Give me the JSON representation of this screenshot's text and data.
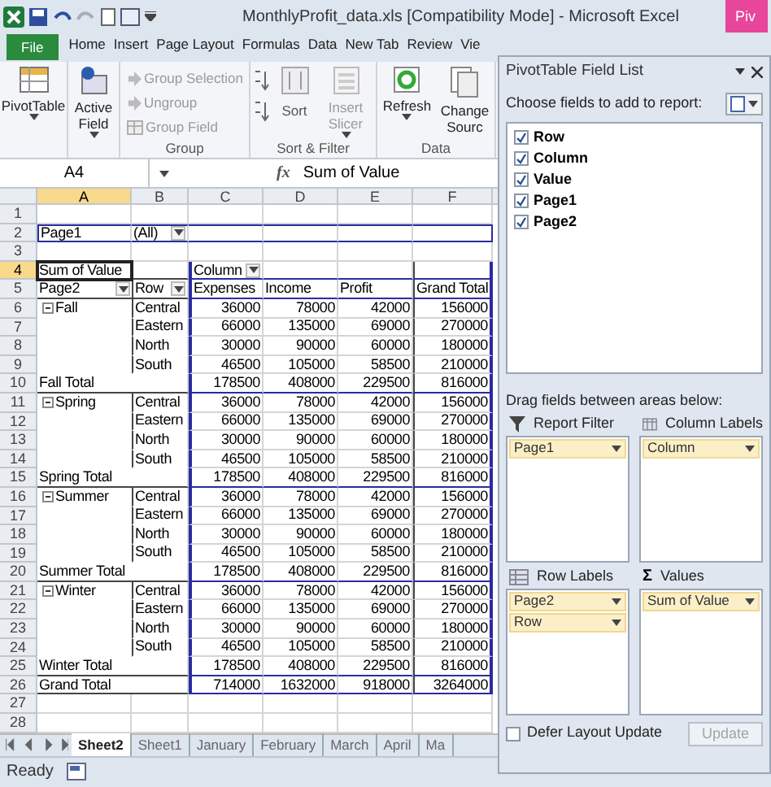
{
  "title_bar": {
    "title": "MonthlyProfit_data.xls  [Compatibility Mode]  -  Microsoft Excel",
    "context_tab": "Piv"
  },
  "ribbon_tabs": [
    {
      "label": "File",
      "kind": "file",
      "selected": false
    },
    {
      "label": "Home",
      "kind": "tab",
      "selected": false
    },
    {
      "label": "Insert",
      "kind": "tab",
      "selected": false
    },
    {
      "label": "Page Layout",
      "kind": "tab",
      "selected": false
    },
    {
      "label": "Formulas",
      "kind": "tab",
      "selected": false
    },
    {
      "label": "Data",
      "kind": "tab",
      "selected": false
    },
    {
      "label": "New Tab",
      "kind": "tab",
      "selected": false
    },
    {
      "label": "Review",
      "kind": "tab",
      "selected": false
    },
    {
      "label": "Vie",
      "kind": "tab",
      "selected": false
    }
  ],
  "ribbon_groups": [
    {
      "buttons": [
        {
          "label": "PivotTable",
          "kind": "large",
          "disabled": false,
          "dropdown": true
        }
      ]
    },
    {
      "buttons": [
        {
          "label": "Active Field",
          "kind": "large",
          "disabled": false,
          "dropdown": true
        }
      ]
    },
    {
      "label": "Group",
      "buttons": [
        {
          "label": "Group Selection",
          "kind": "small",
          "disabled": true
        },
        {
          "label": "Ungroup",
          "kind": "small",
          "disabled": true
        },
        {
          "label": "Group Field",
          "kind": "small",
          "disabled": true
        }
      ]
    },
    {
      "label": "Sort & Filter",
      "buttons": [
        {
          "label": "Sort",
          "kind": "sort",
          "disabled": false
        },
        {
          "label": "Insert Slicer",
          "kind": "large",
          "disabled": true,
          "dropdown": true
        }
      ]
    },
    {
      "label": "Data",
      "buttons": [
        {
          "label": "Refresh",
          "kind": "large",
          "disabled": false,
          "dropdown": true
        },
        {
          "label": "Change Sourc",
          "kind": "large",
          "disabled": false
        }
      ]
    }
  ],
  "formula_bar": {
    "name_box": "A4",
    "function_label": "fx",
    "value": "Sum of Value"
  },
  "sheet": {
    "columns": [
      {
        "label": "A",
        "selected": true
      },
      {
        "label": "B",
        "selected": false
      },
      {
        "label": "C",
        "selected": false
      },
      {
        "label": "D",
        "selected": false
      },
      {
        "label": "E",
        "selected": false
      },
      {
        "label": "F",
        "selected": false
      }
    ],
    "rows": [
      {
        "num": "1",
        "kind": "blank",
        "selected": false
      },
      {
        "num": "2",
        "kind": "filter",
        "selected": false,
        "cells": {
          "A": "Page1",
          "B": "(All)"
        }
      },
      {
        "num": "3",
        "kind": "blank",
        "selected": false
      },
      {
        "num": "4",
        "kind": "column_labels",
        "selected": true,
        "cells": {
          "A": "Sum of Value",
          "C": "Column"
        }
      },
      {
        "num": "5",
        "kind": "field_header",
        "selected": false,
        "cells": {
          "A": "Page2",
          "B": "Row",
          "C": "Expenses",
          "D": "Income",
          "E": "Profit",
          "F": "Grand Total"
        }
      },
      {
        "num": "6",
        "kind": "item",
        "selected": false,
        "expanded": true,
        "cells": {
          "A": "Fall",
          "B": "Central",
          "C": "36000",
          "D": "78000",
          "E": "42000",
          "F": "156000"
        }
      },
      {
        "num": "7",
        "kind": "item",
        "selected": false,
        "cells": {
          "B": "Eastern",
          "C": "66000",
          "D": "135000",
          "E": "69000",
          "F": "270000"
        }
      },
      {
        "num": "8",
        "kind": "item",
        "selected": false,
        "cells": {
          "B": "North",
          "C": "30000",
          "D": "90000",
          "E": "60000",
          "F": "180000"
        }
      },
      {
        "num": "9",
        "kind": "item",
        "selected": false,
        "cells": {
          "B": "South",
          "C": "46500",
          "D": "105000",
          "E": "58500",
          "F": "210000"
        }
      },
      {
        "num": "10",
        "kind": "subtotal",
        "selected": false,
        "cells": {
          "A": "Fall Total",
          "C": "178500",
          "D": "408000",
          "E": "229500",
          "F": "816000"
        }
      },
      {
        "num": "11",
        "kind": "item",
        "selected": false,
        "expanded": true,
        "cells": {
          "A": "Spring",
          "B": "Central",
          "C": "36000",
          "D": "78000",
          "E": "42000",
          "F": "156000"
        }
      },
      {
        "num": "12",
        "kind": "item",
        "selected": false,
        "cells": {
          "B": "Eastern",
          "C": "66000",
          "D": "135000",
          "E": "69000",
          "F": "270000"
        }
      },
      {
        "num": "13",
        "kind": "item",
        "selected": false,
        "cells": {
          "B": "North",
          "C": "30000",
          "D": "90000",
          "E": "60000",
          "F": "180000"
        }
      },
      {
        "num": "14",
        "kind": "item",
        "selected": false,
        "cells": {
          "B": "South",
          "C": "46500",
          "D": "105000",
          "E": "58500",
          "F": "210000"
        }
      },
      {
        "num": "15",
        "kind": "subtotal",
        "selected": false,
        "cells": {
          "A": "Spring Total",
          "C": "178500",
          "D": "408000",
          "E": "229500",
          "F": "816000"
        }
      },
      {
        "num": "16",
        "kind": "item",
        "selected": false,
        "expanded": true,
        "cells": {
          "A": "Summer",
          "B": "Central",
          "C": "36000",
          "D": "78000",
          "E": "42000",
          "F": "156000"
        }
      },
      {
        "num": "17",
        "kind": "item",
        "selected": false,
        "cells": {
          "B": "Eastern",
          "C": "66000",
          "D": "135000",
          "E": "69000",
          "F": "270000"
        }
      },
      {
        "num": "18",
        "kind": "item",
        "selected": false,
        "cells": {
          "B": "North",
          "C": "30000",
          "D": "90000",
          "E": "60000",
          "F": "180000"
        }
      },
      {
        "num": "19",
        "kind": "item",
        "selected": false,
        "cells": {
          "B": "South",
          "C": "46500",
          "D": "105000",
          "E": "58500",
          "F": "210000"
        }
      },
      {
        "num": "20",
        "kind": "subtotal",
        "selected": false,
        "cells": {
          "A": "Summer Total",
          "C": "178500",
          "D": "408000",
          "E": "229500",
          "F": "816000"
        }
      },
      {
        "num": "21",
        "kind": "item",
        "selected": false,
        "expanded": true,
        "cells": {
          "A": "Winter",
          "B": "Central",
          "C": "36000",
          "D": "78000",
          "E": "42000",
          "F": "156000"
        }
      },
      {
        "num": "22",
        "kind": "item",
        "selected": false,
        "cells": {
          "B": "Eastern",
          "C": "66000",
          "D": "135000",
          "E": "69000",
          "F": "270000"
        }
      },
      {
        "num": "23",
        "kind": "item",
        "selected": false,
        "cells": {
          "B": "North",
          "C": "30000",
          "D": "90000",
          "E": "60000",
          "F": "180000"
        }
      },
      {
        "num": "24",
        "kind": "item",
        "selected": false,
        "cells": {
          "B": "South",
          "C": "46500",
          "D": "105000",
          "E": "58500",
          "F": "210000"
        }
      },
      {
        "num": "25",
        "kind": "subtotal",
        "selected": false,
        "cells": {
          "A": "Winter Total",
          "C": "178500",
          "D": "408000",
          "E": "229500",
          "F": "816000"
        }
      },
      {
        "num": "26",
        "kind": "grand_total",
        "selected": false,
        "cells": {
          "A": "Grand Total",
          "C": "714000",
          "D": "1632000",
          "E": "918000",
          "F": "3264000"
        }
      },
      {
        "num": "27",
        "kind": "blank",
        "selected": false
      },
      {
        "num": "28",
        "kind": "blank",
        "selected": false
      }
    ],
    "tabs": [
      {
        "label": "Sheet2",
        "selected": true
      },
      {
        "label": "Sheet1",
        "selected": false
      },
      {
        "label": "January",
        "selected": false
      },
      {
        "label": "February",
        "selected": false
      },
      {
        "label": "March",
        "selected": false
      },
      {
        "label": "April",
        "selected": false
      },
      {
        "label": "Ma",
        "selected": false
      }
    ]
  },
  "status_bar": {
    "text": "Ready"
  },
  "field_list": {
    "title": "PivotTable Field List",
    "choose_label": "Choose fields to add to report:",
    "fields": [
      {
        "label": "Row",
        "checked": true
      },
      {
        "label": "Column",
        "checked": true
      },
      {
        "label": "Value",
        "checked": true
      },
      {
        "label": "Page1",
        "checked": true
      },
      {
        "label": "Page2",
        "checked": true
      }
    ],
    "drag_label": "Drag fields between areas below:",
    "areas": [
      {
        "label": "Report Filter",
        "kind": "filter",
        "items": [
          "Page1"
        ]
      },
      {
        "label": "Column Labels",
        "kind": "columns",
        "items": [
          "Column"
        ]
      },
      {
        "label": "Row Labels",
        "kind": "rows",
        "items": [
          "Page2",
          "Row"
        ]
      },
      {
        "label": "Values",
        "kind": "values",
        "symbol": "Σ",
        "items": [
          "Sum of Value"
        ]
      }
    ],
    "defer": {
      "label": "Defer Layout Update",
      "checked": false
    },
    "update_button": {
      "label": "Update",
      "disabled": true
    }
  }
}
